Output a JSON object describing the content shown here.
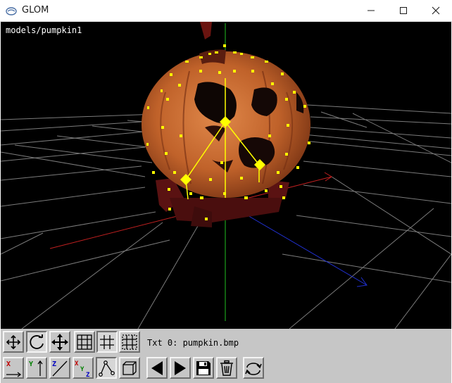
{
  "window": {
    "title": "GLOM",
    "icon": "glom-app-icon",
    "controls": [
      "minimize-icon",
      "maximize-icon",
      "close-icon"
    ]
  },
  "viewport": {
    "model_name": "models/pumpkin1",
    "background": "#000000",
    "axis_colors": {
      "x": "#c02020",
      "y": "#20c020",
      "z": "#2030d0"
    },
    "handle_color": "#ffff00"
  },
  "toolbar": {
    "texture_info": "Txt 0: pumpkin.bmp",
    "row1": [
      {
        "name": "rotate-select-button",
        "icon": "move-arrows-icon",
        "pressed": false
      },
      {
        "name": "rotate-button",
        "icon": "rotate-arrows-icon",
        "pressed": true
      },
      {
        "name": "translate-button",
        "icon": "cross-arrows-icon",
        "pressed": false
      },
      {
        "name": "grid-full-button",
        "icon": "grid-icon",
        "pressed": false
      },
      {
        "name": "grid-inner-button",
        "icon": "grid-inner-icon",
        "pressed": true
      },
      {
        "name": "grid-dotted-button",
        "icon": "grid-dotted-icon",
        "pressed": false
      }
    ],
    "row2": [
      {
        "name": "axis-x-button",
        "icon": "axis-x-icon",
        "pressed": false
      },
      {
        "name": "axis-y-button",
        "icon": "axis-y-icon",
        "pressed": false
      },
      {
        "name": "axis-z-button",
        "icon": "axis-z-icon",
        "pressed": false
      },
      {
        "name": "axis-xyz-button",
        "icon": "axis-xyz-icon",
        "pressed": false
      },
      {
        "name": "skeleton-button",
        "icon": "skeleton-icon",
        "pressed": true
      },
      {
        "name": "box-view-button",
        "icon": "cube-icon",
        "pressed": false
      },
      {
        "name": "previous-button",
        "icon": "triangle-left-icon",
        "pressed": false
      },
      {
        "name": "next-button",
        "icon": "triangle-right-icon",
        "pressed": false
      },
      {
        "name": "save-button",
        "icon": "floppy-disk-icon",
        "pressed": false
      },
      {
        "name": "delete-button",
        "icon": "trash-icon",
        "pressed": false
      },
      {
        "name": "reset-view-button",
        "icon": "refresh-arrows-icon",
        "pressed": false
      }
    ],
    "axis_labels": {
      "x": "X",
      "y": "Y",
      "z": "Z",
      "xyz_x": "X",
      "xyz_y": "Y",
      "xyz_z": "Z"
    },
    "axis_label_colors": {
      "x": "#c00000",
      "y": "#008000",
      "z": "#0000c0"
    }
  }
}
